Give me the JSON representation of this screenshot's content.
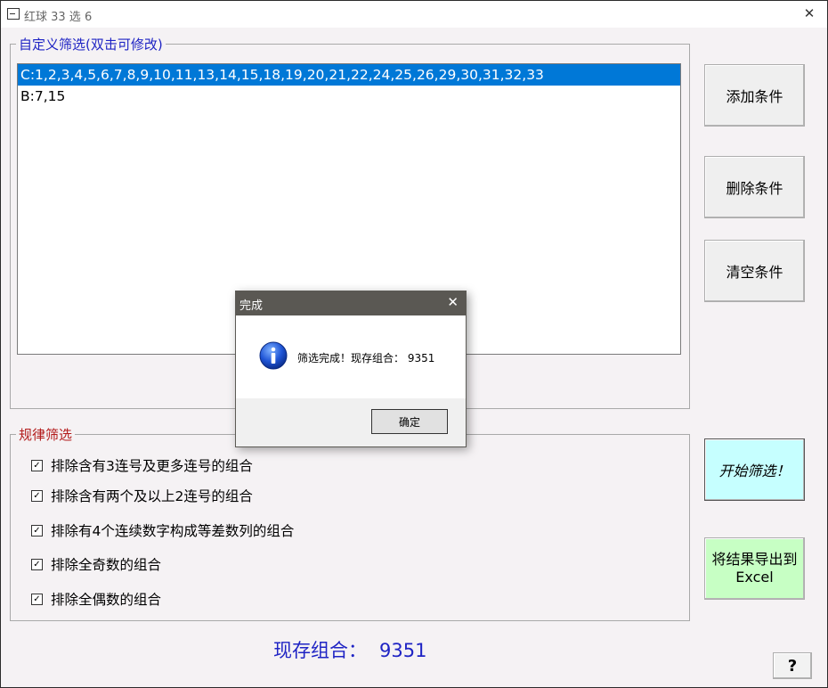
{
  "window": {
    "title": "红球 33 选 6",
    "close_glyph": "✕"
  },
  "custom_filter": {
    "legend": "自定义筛选(双击可修改)",
    "items": [
      {
        "text": "C:1,2,3,4,5,6,7,8,9,10,11,13,14,15,18,19,20,21,22,24,25,26,29,30,31,32,33",
        "selected": true
      },
      {
        "text": "B:7,15",
        "selected": false
      }
    ]
  },
  "buttons": {
    "add": "添加条件",
    "delete": "删除条件",
    "clear": "清空条件",
    "start": "开始筛选！",
    "export_line1": "将结果导出到",
    "export_line2": "Excel",
    "help": "?"
  },
  "rule_filter": {
    "legend": "规律筛选",
    "rules": [
      {
        "label": "排除含有3连号及更多连号的组合",
        "checked": true
      },
      {
        "label": "排除含有两个及以上2连号的组合",
        "checked": true
      },
      {
        "label": "排除有4个连续数字构成等差数列的组合",
        "checked": true
      },
      {
        "label": "排除全奇数的组合",
        "checked": true
      },
      {
        "label": "排除全偶数的组合",
        "checked": true
      }
    ]
  },
  "status": {
    "label": "现存组合：",
    "value": "9351"
  },
  "dialog": {
    "title": "完成",
    "close_glyph": "✕",
    "message": "筛选完成！现存组合： 9351",
    "ok": "确定",
    "icon": "info-icon"
  },
  "colors": {
    "selection": "#0078d7",
    "start_button": "#c6ffff",
    "export_button": "#c7ffc4",
    "status_text": "#1f24c4",
    "rules_legend": "#b31b1b"
  }
}
